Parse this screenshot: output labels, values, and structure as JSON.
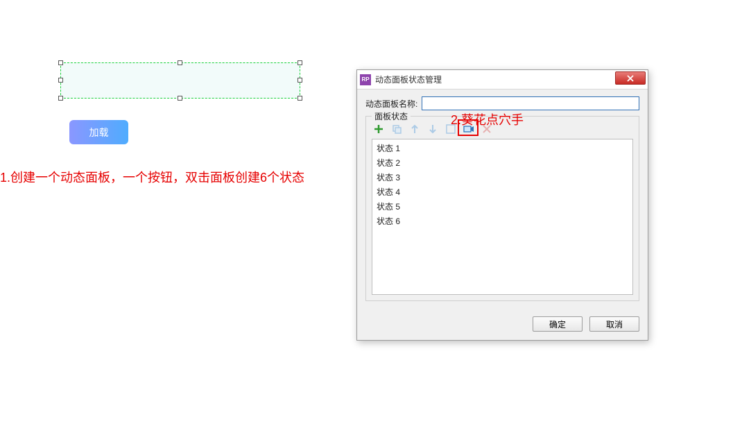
{
  "left": {
    "load_button_label": "加载",
    "annotation1": "1.创建一个动态面板，一个按钮，双击面板创建6个状态",
    "annotation2": "2.葵花点穴手"
  },
  "dialog": {
    "rp_badge": "RP",
    "title": "动态面板状态管理",
    "name_label": "动态面板名称:",
    "name_value": "",
    "states_label": "面板状态",
    "toolbar_icons": {
      "add": "add-icon",
      "copy": "copy-icon",
      "up": "arrow-up-icon",
      "down": "arrow-down-icon",
      "edit": "edit-icon",
      "delete": "delete-icon",
      "remove": "remove-icon"
    },
    "state_items": [
      "状态 1",
      "状态 2",
      "状态 3",
      "状态 4",
      "状态 5",
      "状态 6"
    ],
    "ok_label": "确定",
    "cancel_label": "取消"
  }
}
